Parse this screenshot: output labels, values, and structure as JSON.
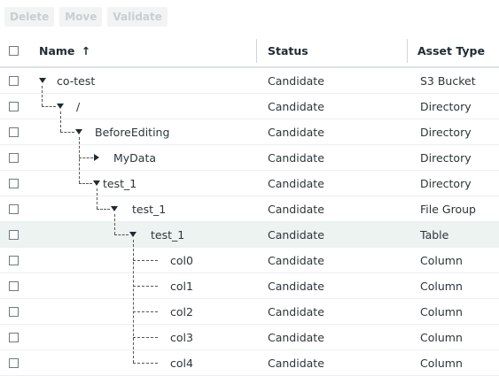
{
  "toolbar": {
    "delete_label": "Delete",
    "move_label": "Move",
    "validate_label": "Validate"
  },
  "columns": {
    "name": "Name",
    "sort_arrow": "↑",
    "status": "Status",
    "asset_type": "Asset Type"
  },
  "rows": [
    {
      "name": "co-test",
      "status": "Candidate",
      "asset_type": "S3 Bucket"
    },
    {
      "name": "/",
      "status": "Candidate",
      "asset_type": "Directory"
    },
    {
      "name": "BeforeEditing",
      "status": "Candidate",
      "asset_type": "Directory"
    },
    {
      "name": "MyData",
      "status": "Candidate",
      "asset_type": "Directory"
    },
    {
      "name": "test_1",
      "status": "Candidate",
      "asset_type": "Directory"
    },
    {
      "name": "test_1",
      "status": "Candidate",
      "asset_type": "File Group"
    },
    {
      "name": "test_1",
      "status": "Candidate",
      "asset_type": "Table"
    },
    {
      "name": "col0",
      "status": "Candidate",
      "asset_type": "Column"
    },
    {
      "name": "col1",
      "status": "Candidate",
      "asset_type": "Column"
    },
    {
      "name": "col2",
      "status": "Candidate",
      "asset_type": "Column"
    },
    {
      "name": "col3",
      "status": "Candidate",
      "asset_type": "Column"
    },
    {
      "name": "col4",
      "status": "Candidate",
      "asset_type": "Column"
    }
  ]
}
